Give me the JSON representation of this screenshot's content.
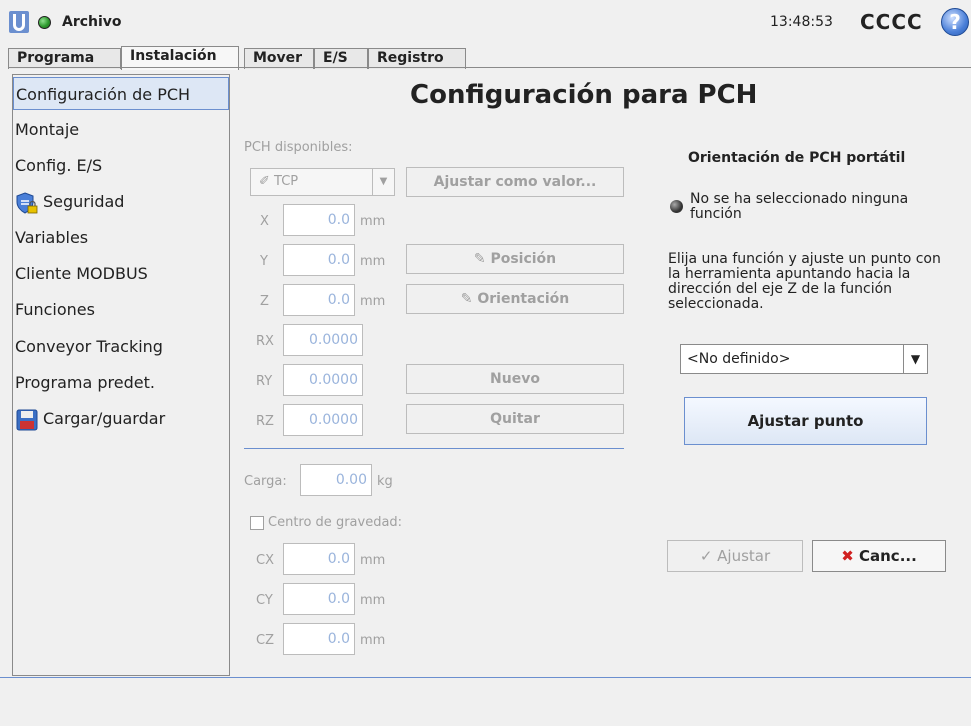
{
  "header": {
    "file_label": "Archivo",
    "clock": "13:48:53",
    "robot_name": "CCCC",
    "help_glyph": "?",
    "status_color": "#2e9a2e"
  },
  "tabs": [
    {
      "label": "Programa",
      "active": false
    },
    {
      "label": "Instalación",
      "active": true
    },
    {
      "label": "Mover",
      "active": false
    },
    {
      "label": "E/S",
      "active": false
    },
    {
      "label": "Registro",
      "active": false
    }
  ],
  "sidebar": {
    "items": [
      {
        "label": "Configuración de PCH",
        "active": true
      },
      {
        "label": "Montaje"
      },
      {
        "label": "Config. E/S"
      },
      {
        "label": "Seguridad",
        "icon": "shield-lock-icon"
      },
      {
        "label": "Variables"
      },
      {
        "label": "Cliente MODBUS"
      },
      {
        "label": "Funciones"
      },
      {
        "label": "Conveyor Tracking"
      },
      {
        "label": "Programa predet."
      },
      {
        "label": "Cargar/guardar",
        "icon": "floppy-disk-icon"
      }
    ]
  },
  "main": {
    "title": "Configuración para PCH",
    "available_label": "PCH disponibles:",
    "tcp_select": "TCP",
    "set_as_default": "Ajustar como valor...",
    "position_button": "Posición",
    "orientation_button": "Orientación",
    "new_button": "Nuevo",
    "remove_button": "Quitar",
    "fields": [
      {
        "label": "X",
        "value": "0.0",
        "unit": "mm"
      },
      {
        "label": "Y",
        "value": "0.0",
        "unit": "mm"
      },
      {
        "label": "Z",
        "value": "0.0",
        "unit": "mm"
      },
      {
        "label": "RX",
        "value": "0.0000"
      },
      {
        "label": "RY",
        "value": "0.0000"
      },
      {
        "label": "RZ",
        "value": "0.0000"
      }
    ],
    "payload_label": "Carga:",
    "payload_value": "0.00",
    "payload_unit": "kg",
    "cog_label": "Centro de gravedad:",
    "cog_fields": [
      {
        "label": "CX",
        "value": "0.0",
        "unit": "mm"
      },
      {
        "label": "CY",
        "value": "0.0",
        "unit": "mm"
      },
      {
        "label": "CZ",
        "value": "0.0",
        "unit": "mm"
      }
    ],
    "orientation_title": "Orientación de PCH portátil",
    "no_feature": "No se ha seleccionado ninguna función",
    "instructions": "Elija una función y ajuste un punto con la herramienta apuntando hacia la dirección del eje Z de la función seleccionada.",
    "feature_select": "<No definido>",
    "set_point": "Ajustar punto",
    "apply": "Ajustar",
    "cancel": "Canc..."
  }
}
